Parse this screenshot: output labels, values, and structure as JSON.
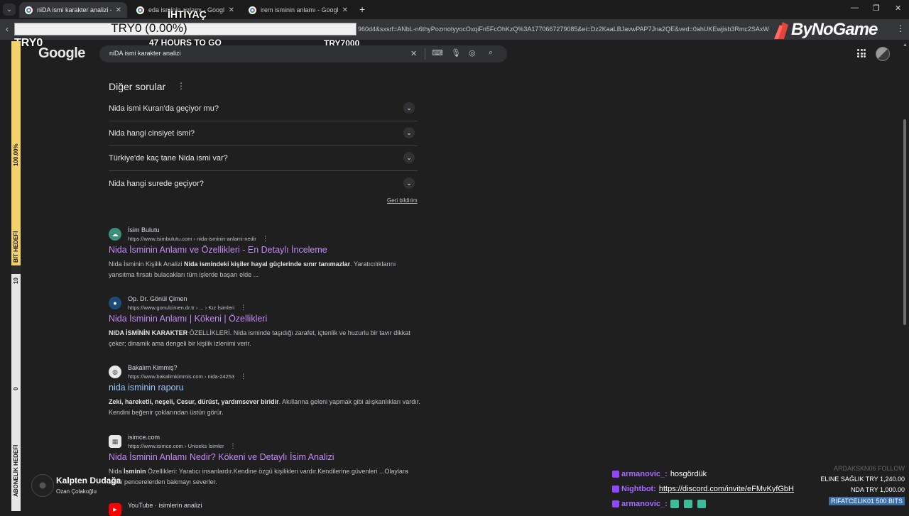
{
  "tabs": [
    {
      "label": "niDA ismi karakter analizi - Goo",
      "active": true
    },
    {
      "label": "eda isminin anlamı - Google'da",
      "active": false
    },
    {
      "label": "irem isminin anlamı - Google'da",
      "active": false
    }
  ],
  "new_tab": "+",
  "address": {
    "url_fragment": "960d4&sxsrf=ANbL-n6thyPozmotyyocOxqiFn5FcOhKzQ%3A1770667279085&ei=Dz2KaaLBJavwPAP7Jna2QE&ved=0ahUKEwjisb3Rmc2SAxW"
  },
  "overlay": {
    "goal_title": "İHTİYAÇ",
    "goal_amount": "TRY0 (0.00%)",
    "goal_time": "47 HOURS TO GO",
    "goal_min": "TRY0",
    "goal_max": "TRY7000",
    "brand": "ByNoGame",
    "bit_percent": "100.00%",
    "bit_label": "BİT HEDEFİ",
    "sub_top": "10",
    "sub_bottom": "0",
    "sub_label": "ABONELİK HEDEFİ"
  },
  "google": {
    "logo": "Google",
    "query": "niDA ismi karakter analizi"
  },
  "others": {
    "title": "Diğer sorular",
    "questions": [
      "Nida ismi Kuran'da geçiyor mu?",
      "Nida hangi cinsiyet ismi?",
      "Türkiye'de kaç tane Nida ismi var?",
      "Nida hangi surede geçiyor?"
    ],
    "feedback": "Geri bildirim"
  },
  "results": [
    {
      "site": "İsim Bulutu",
      "url": "https://www.isimbulutu.com › nida-isminin-anlami-nedir",
      "title": "Nida İsminin Anlamı ve Özellikleri - En Detaylı İnceleme",
      "snippet_pre": "Nida İsminin Kişilik Analizi ",
      "snippet_bold": "Nida ismindeki kişiler hayal güçlerinde sınır tanımazlar",
      "snippet_post": ". Yaratıcılıklarını yansıtma fırsatı bulacakları tüm işlerde başarı elde ..."
    },
    {
      "site": "Op. Dr. Gönül Çimen",
      "url": "https://www.gonulcimen.dr.tr › ... › Kız İsimleri",
      "title": "Nida İsminin Anlamı | Kökeni | Özellikleri",
      "snippet_pre": "",
      "snippet_bold": "NIDA İSMİNİN KARAKTER",
      "snippet_post": " ÖZELLİKLERİ. Nida isminde taşıdığı zarafet, içtenlik ve huzurlu bir tavır dikkat çeker; dinamik ama dengeli bir kişilik izlenimi verir."
    },
    {
      "site": "Bakalım Kimmiş?",
      "url": "https://www.bakalimkimmis.com › nida-24253",
      "title": "nida isminin raporu",
      "snippet_pre": "",
      "snippet_bold": "Zeki, hareketli, neşeli, Cesur, dürüst, yardımsever biridir",
      "snippet_post": ". Akıllarına geleni yapmak gibi alışkanlıkları vardır. Kendini beğenir çoklarından üstün görür."
    },
    {
      "site": "isimce.com",
      "url": "https://www.isimce.com › Uniseks İsimler",
      "title": "Nida İsminin Anlamı Nedir? Kökeni ve Detaylı İsim Analizi",
      "snippet_pre": "Nida ",
      "snippet_bold": "İsminin",
      "snippet_post": " Özellikleri: Yaratıcı insanlardır.Kendine özgü kişilikleri vardır.Kendilerine güvenleri ...Olaylara farklı pencerelerden bakmayı severler."
    },
    {
      "site": "YouTube · isimlerin analizi",
      "url": "",
      "title": "",
      "snippet_pre": "",
      "snippet_bold": "",
      "snippet_post": ""
    }
  ],
  "now_playing": {
    "title": "Kalpten Dudağa",
    "artist": "Ozan Çolakoğlu"
  },
  "chat": [
    {
      "user": "armanovic_:",
      "message": "hosgördük",
      "link": ""
    },
    {
      "user": "Nightbot:",
      "message": "",
      "link": "https://discord.com/invite/eFMvKyfGbH"
    },
    {
      "user": "armanovic_:",
      "message": "",
      "link": ""
    }
  ],
  "events": [
    {
      "text": "ARDAKSKN06 FOLLOW",
      "faded": true
    },
    {
      "text": "ELINE SAĞLIK  TRY 1,240.00",
      "faded": false
    },
    {
      "text": "NDA  TRY 1,000.00",
      "faded": false
    },
    {
      "text": "RIFATCELIK01  500 BITS",
      "faded": false
    }
  ],
  "colors": {
    "visited_link": "#c58af9",
    "link": "#99c3ff",
    "twitch": "#9146ff",
    "goal_yellow": "#f3d26a"
  }
}
